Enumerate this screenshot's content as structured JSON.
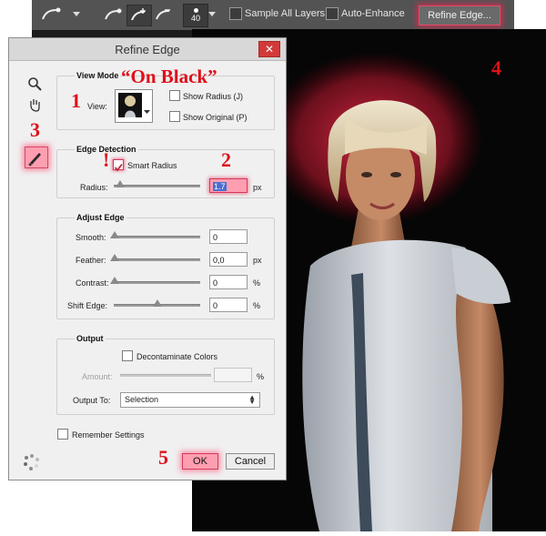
{
  "options_bar": {
    "brush_size": "40",
    "sample_all_layers": "Sample All Layers",
    "auto_enhance": "Auto-Enhance",
    "refine_edge": "Refine Edge..."
  },
  "dialog": {
    "title": "Refine Edge",
    "view_mode": {
      "heading": "View Mode",
      "view_label": "View:",
      "show_radius": "Show Radius (J)",
      "show_original": "Show Original (P)"
    },
    "edge_detection": {
      "heading": "Edge Detection",
      "smart_radius": "Smart Radius",
      "radius_label": "Radius:",
      "radius_value": "1.7",
      "radius_unit": "px"
    },
    "adjust_edge": {
      "heading": "Adjust Edge",
      "smooth_label": "Smooth:",
      "smooth_value": "0",
      "feather_label": "Feather:",
      "feather_value": "0,0",
      "feather_unit": "px",
      "contrast_label": "Contrast:",
      "contrast_value": "0",
      "contrast_unit": "%",
      "shift_label": "Shift Edge:",
      "shift_value": "0",
      "shift_unit": "%"
    },
    "output": {
      "heading": "Output",
      "decontaminate": "Decontaminate Colors",
      "amount_label": "Amount:",
      "amount_unit": "%",
      "output_to_label": "Output To:",
      "output_to_value": "Selection"
    },
    "remember": "Remember Settings",
    "ok": "OK",
    "cancel": "Cancel"
  },
  "annotations": {
    "on_black": "“On Black”",
    "n1": "1",
    "n2": "2",
    "n3": "3",
    "n4": "4",
    "n5": "5",
    "excl": "!"
  },
  "colors": {
    "annotation_red": "#e0101a",
    "highlight_glow": "#ff2d5a",
    "dialog_bg": "#f0f0f0",
    "optbar_bg": "#535353"
  }
}
